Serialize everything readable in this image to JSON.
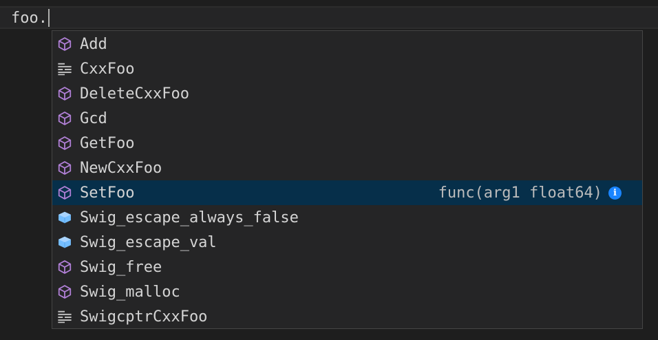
{
  "editor": {
    "line_text": "foo."
  },
  "suggestions": {
    "items": [
      {
        "label": "Add",
        "kind": "method-icon"
      },
      {
        "label": "CxxFoo",
        "kind": "struct-icon"
      },
      {
        "label": "DeleteCxxFoo",
        "kind": "method-icon"
      },
      {
        "label": "Gcd",
        "kind": "method-icon"
      },
      {
        "label": "GetFoo",
        "kind": "method-icon"
      },
      {
        "label": "NewCxxFoo",
        "kind": "method-icon"
      },
      {
        "label": "SetFoo",
        "kind": "method-icon",
        "detail": "func(arg1 float64)",
        "focused": true
      },
      {
        "label": "Swig_escape_always_false",
        "kind": "variable-icon"
      },
      {
        "label": "Swig_escape_val",
        "kind": "variable-icon"
      },
      {
        "label": "Swig_free",
        "kind": "method-icon"
      },
      {
        "label": "Swig_malloc",
        "kind": "method-icon"
      },
      {
        "label": "SwigcptrCxxFoo",
        "kind": "struct-icon"
      }
    ],
    "info_icon": "info-icon",
    "info_glyph": "i"
  },
  "colors": {
    "method": "#b180d7",
    "variable": "#75beff",
    "struct": "#c5c5c5",
    "focused_row": "#062f4a",
    "info": "#1a85ff"
  }
}
